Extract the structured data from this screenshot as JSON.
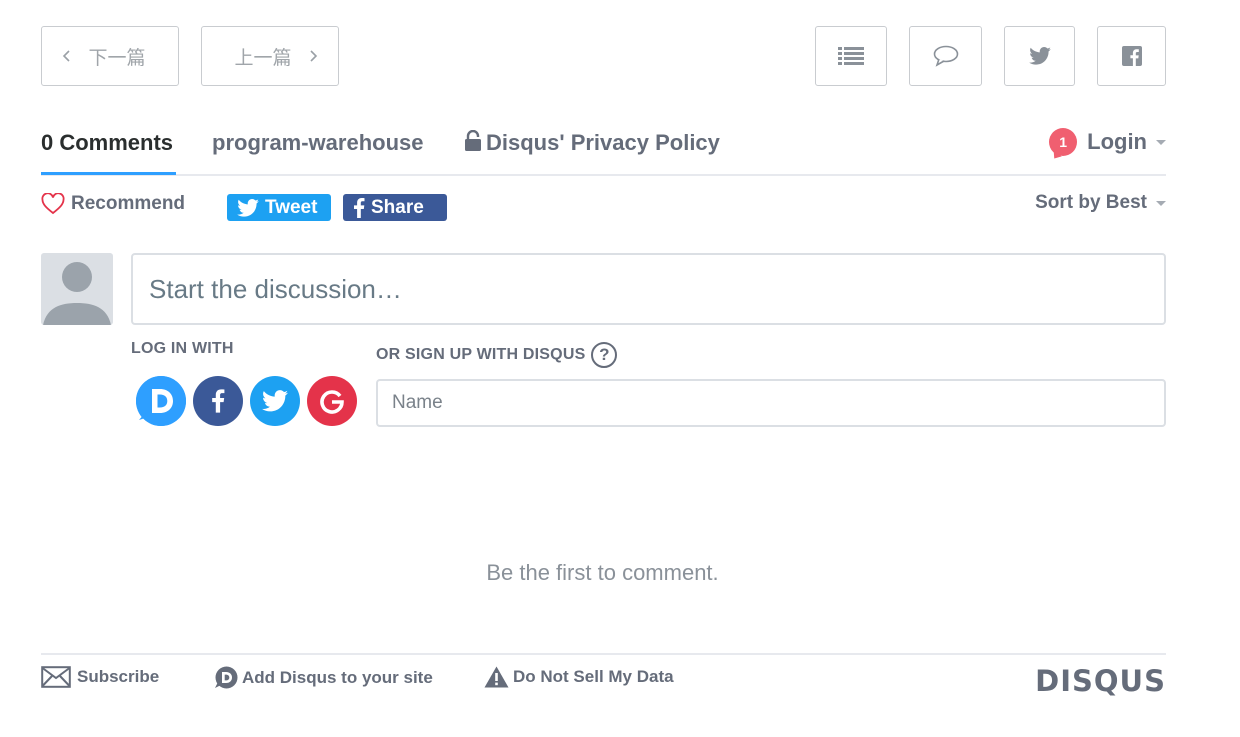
{
  "nav": {
    "next_label": "下一篇",
    "prev_label": "上一篇",
    "icons": [
      "list-icon",
      "comment-icon",
      "twitter-icon",
      "facebook-icon"
    ]
  },
  "tabs": {
    "comments": "0 Comments",
    "community": "program-warehouse",
    "privacy": "Disqus' Privacy Policy",
    "login_badge": "1",
    "login": "Login"
  },
  "actions": {
    "recommend": "Recommend",
    "tweet": "Tweet",
    "share": "Share",
    "sort": "Sort by Best"
  },
  "compose": {
    "placeholder": "Start the discussion…",
    "login_with": "LOG IN WITH",
    "signup_with": "OR SIGN UP WITH DISQUS",
    "help": "?",
    "name_placeholder": "Name"
  },
  "empty_text": "Be the first to comment.",
  "footer": {
    "subscribe": "Subscribe",
    "add_disqus": "Add Disqus to your site",
    "do_not_sell": "Do Not Sell My Data",
    "brand": "DISQUS"
  },
  "colors": {
    "accent": "#2e9fff",
    "badge": "#f05f70",
    "twitter": "#1da1f2",
    "facebook": "#3b5998",
    "google": "#e4334a",
    "disqus": "#2e9fff"
  }
}
